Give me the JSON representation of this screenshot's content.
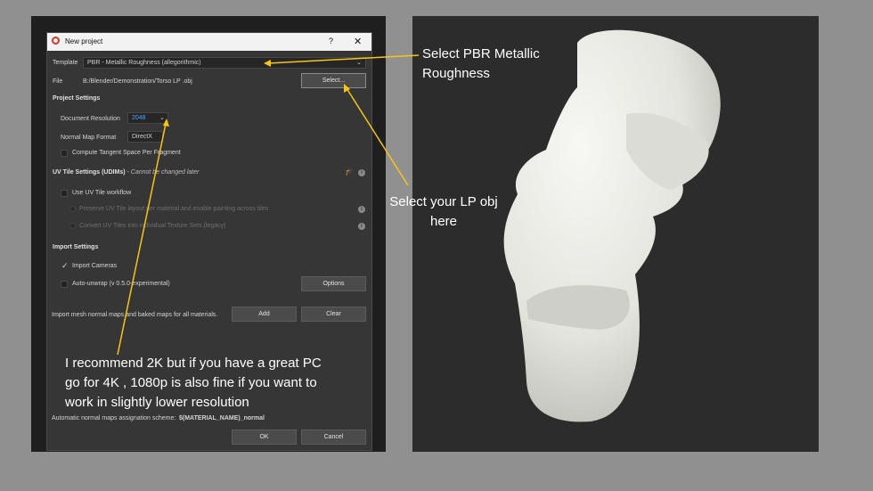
{
  "dialog": {
    "title": "New project",
    "help_glyph": "?",
    "close_glyph": "✕",
    "template_label": "Template",
    "template_value": "PBR - Metallic Roughness (allegorithmic)",
    "file_label": "File",
    "file_value": "B:/Blender/Demonstration/Torso LP .obj",
    "select_button": "Select...",
    "project_settings": {
      "heading": "Project Settings",
      "doc_res_label": "Document Resolution",
      "doc_res_value": "2048",
      "normal_map_label": "Normal Map Format",
      "normal_map_value": "DirectX",
      "tangent_label": "Compute Tangent Space Per Fragment"
    },
    "uv_tile": {
      "heading": "UV Tile Settings (UDIMs)",
      "heading_note": " - Cannot be changed later",
      "workflow_label": "Use UV Tile workflow",
      "preserve_label": "Preserve UV Tile layout per material and enable painting across tiles",
      "convert_label": "Convert UV Tiles into individual Texture Sets (legacy)"
    },
    "import_settings": {
      "heading": "Import Settings",
      "cameras_label": "Import Cameras",
      "autounwrap_label": "Auto-unwrap (v 0.5.0-experimental)",
      "options_button": "Options",
      "mesh_maps_label": "Import mesh normal maps and baked maps for all materials.",
      "add_button": "Add",
      "clear_button": "Clear"
    },
    "scheme_label": "Automatic normal maps assignation scheme:",
    "scheme_value": "$(MATERIAL_NAME)_normal",
    "ok_button": "OK",
    "cancel_button": "Cancel"
  },
  "annotations": {
    "pbr_line1": "Select PBR Metallic",
    "pbr_line2": "Roughness",
    "lp_line1": "Select your LP obj",
    "lp_line2": "here",
    "rec_line1": "I recommend 2K but if you have a great PC",
    "rec_line2": "go for 4K , 1080p is also fine if you want to",
    "rec_line3": "work in slightly lower resolution"
  },
  "colors": {
    "arrow": "#f5c518",
    "highlight_value": "#4ea1ff",
    "slide_bg": "#909090",
    "model": "#e8e8e4"
  }
}
